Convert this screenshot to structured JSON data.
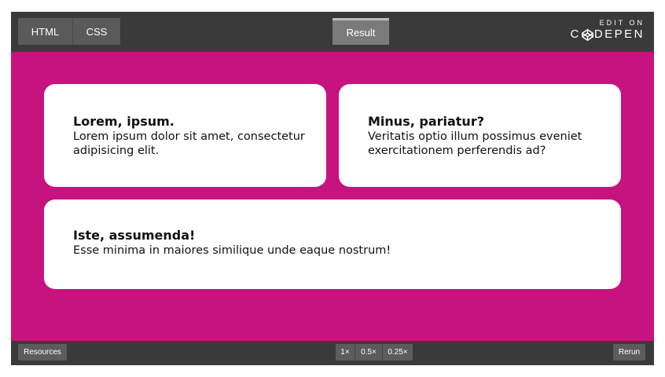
{
  "editor_tabs": {
    "html_label": "HTML",
    "css_label": "CSS",
    "result_label": "Result"
  },
  "brand": {
    "edit_on": "EDIT ON",
    "name_prefix": "C",
    "name_suffix": "DEPEN"
  },
  "colors": {
    "stage_background": "#c7137f",
    "card_background": "#ffffff",
    "bar_background": "#3a3a3a"
  },
  "cards": [
    {
      "title": "Lorem, ipsum.",
      "text": "Lorem ipsum dolor sit amet, consectetur adipisicing elit."
    },
    {
      "title": "Minus, pariatur?",
      "text": "Veritatis optio illum possimus eveniet exercitationem perferendis ad?"
    },
    {
      "title": "Iste, assumenda!",
      "text": "Esse minima in maiores similique unde eaque nostrum!"
    }
  ],
  "footer": {
    "resources_label": "Resources",
    "zoom_options": [
      "1×",
      "0.5×",
      "0.25×"
    ],
    "rerun_label": "Rerun"
  }
}
